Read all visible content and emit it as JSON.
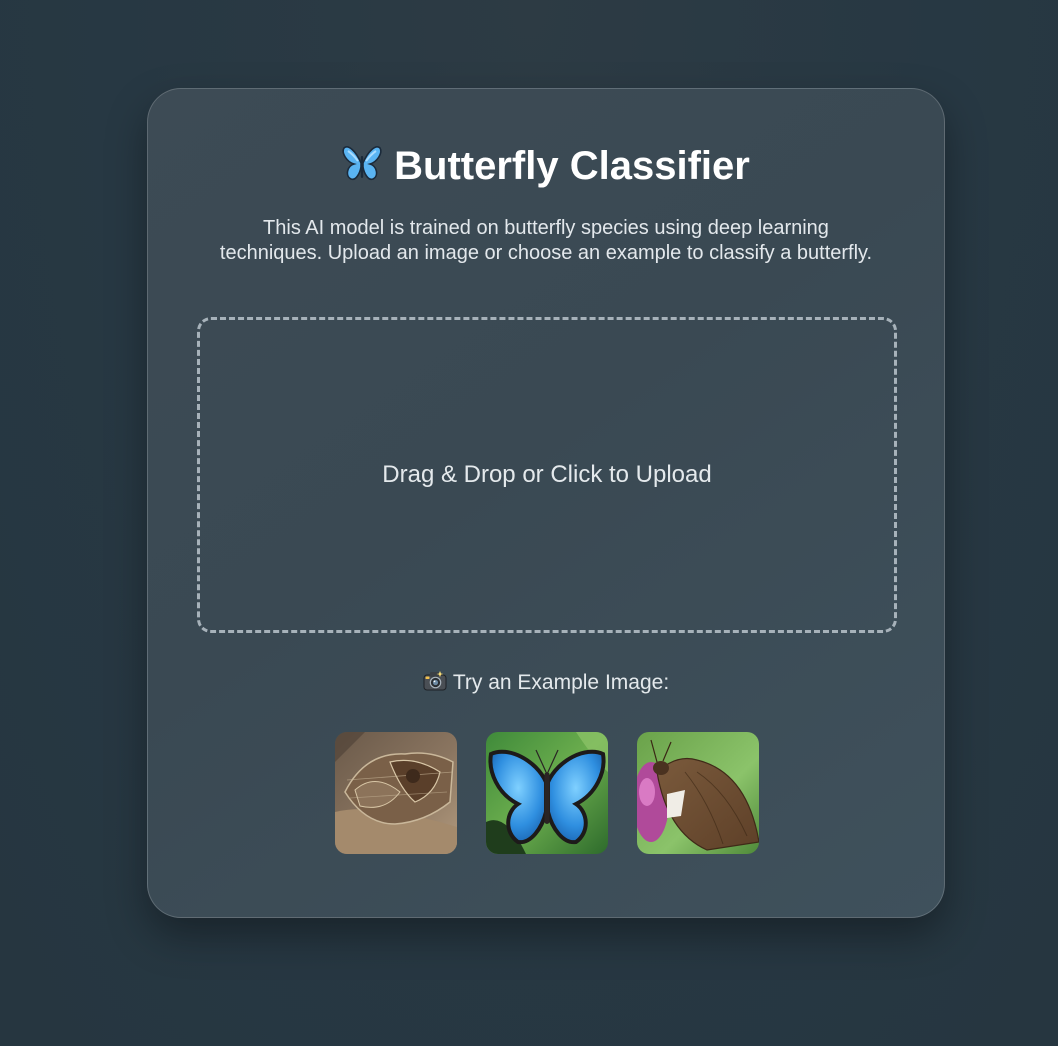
{
  "header": {
    "title": "Butterfly Classifier",
    "title_icon": "butterfly-icon",
    "description": "This AI model is trained on butterfly species using deep learning techniques. Upload an image or choose an example to classify a butterfly."
  },
  "upload": {
    "label": "Drag & Drop or Click to Upload"
  },
  "examples": {
    "heading": "Try an Example Image:",
    "heading_icon": "camera-icon",
    "items": [
      {
        "icon": "moth-example-image"
      },
      {
        "icon": "blue-morpho-example-image"
      },
      {
        "icon": "skipper-example-image"
      }
    ]
  },
  "colors": {
    "background": "#273843",
    "card": "#3c4a54",
    "accent_blue": "#4aa8f0",
    "dropzone_border": "#a7b2ba"
  }
}
